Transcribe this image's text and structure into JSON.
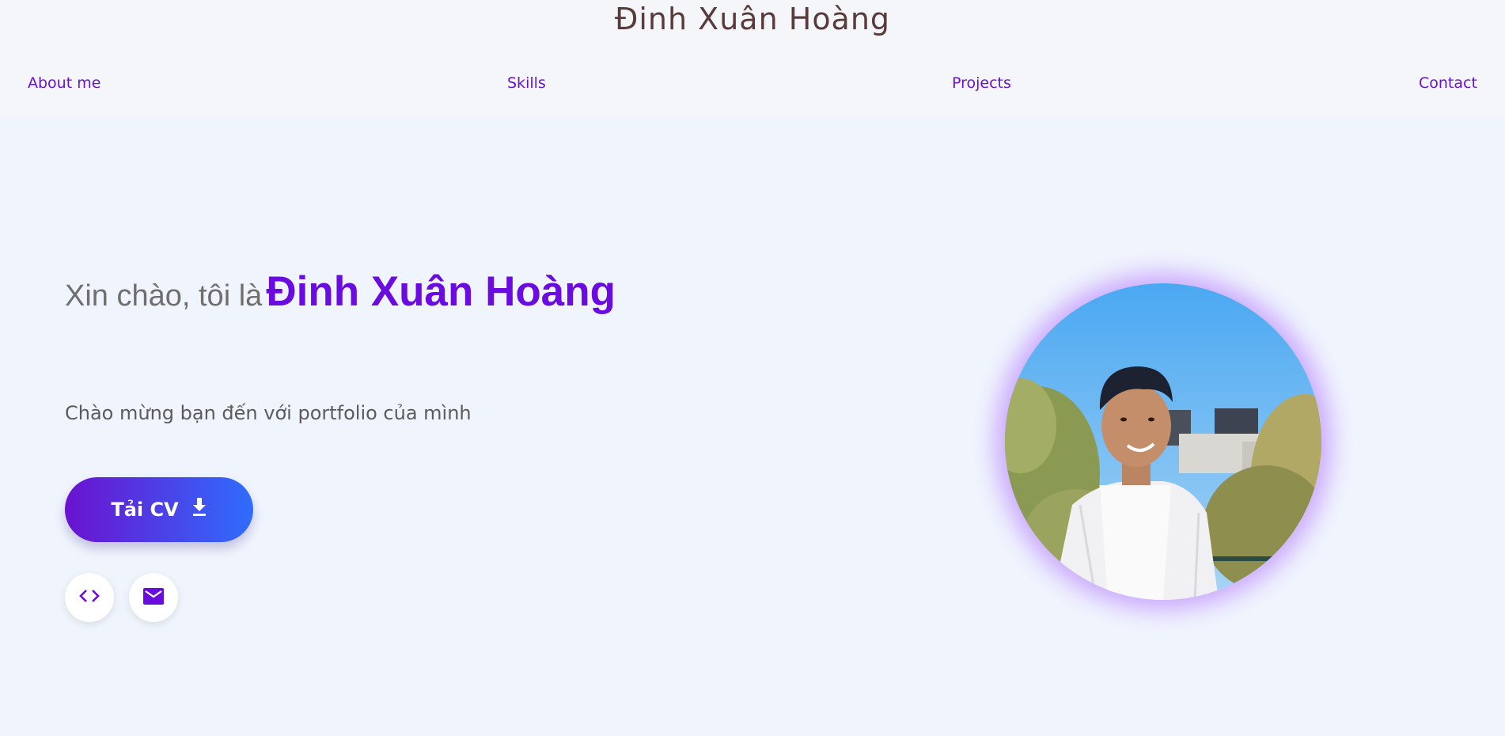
{
  "header": {
    "site_title": "Đinh Xuân Hoàng",
    "nav": [
      {
        "label": "About me"
      },
      {
        "label": "Skills"
      },
      {
        "label": "Projects"
      },
      {
        "label": "Contact"
      }
    ]
  },
  "hero": {
    "greeting": "Xin chào, tôi là",
    "name": "Đinh Xuân Hoàng",
    "subtitle": "Chào mừng bạn đến với portfolio của mình",
    "cv_button_label": "Tải CV",
    "cv_button_icon": "download-icon",
    "social_buttons": [
      {
        "icon": "code-icon"
      },
      {
        "icon": "mail-icon"
      }
    ],
    "photo_icon": "profile-photo"
  },
  "colors": {
    "accent": "#6a0be0",
    "nav_link": "#6a14d1",
    "title": "#5a3b3b",
    "gradient_start": "#6a12cf",
    "gradient_end": "#2f6dfc",
    "page_bg": "#f0f5fd",
    "photo_glow": "#c08cff"
  }
}
